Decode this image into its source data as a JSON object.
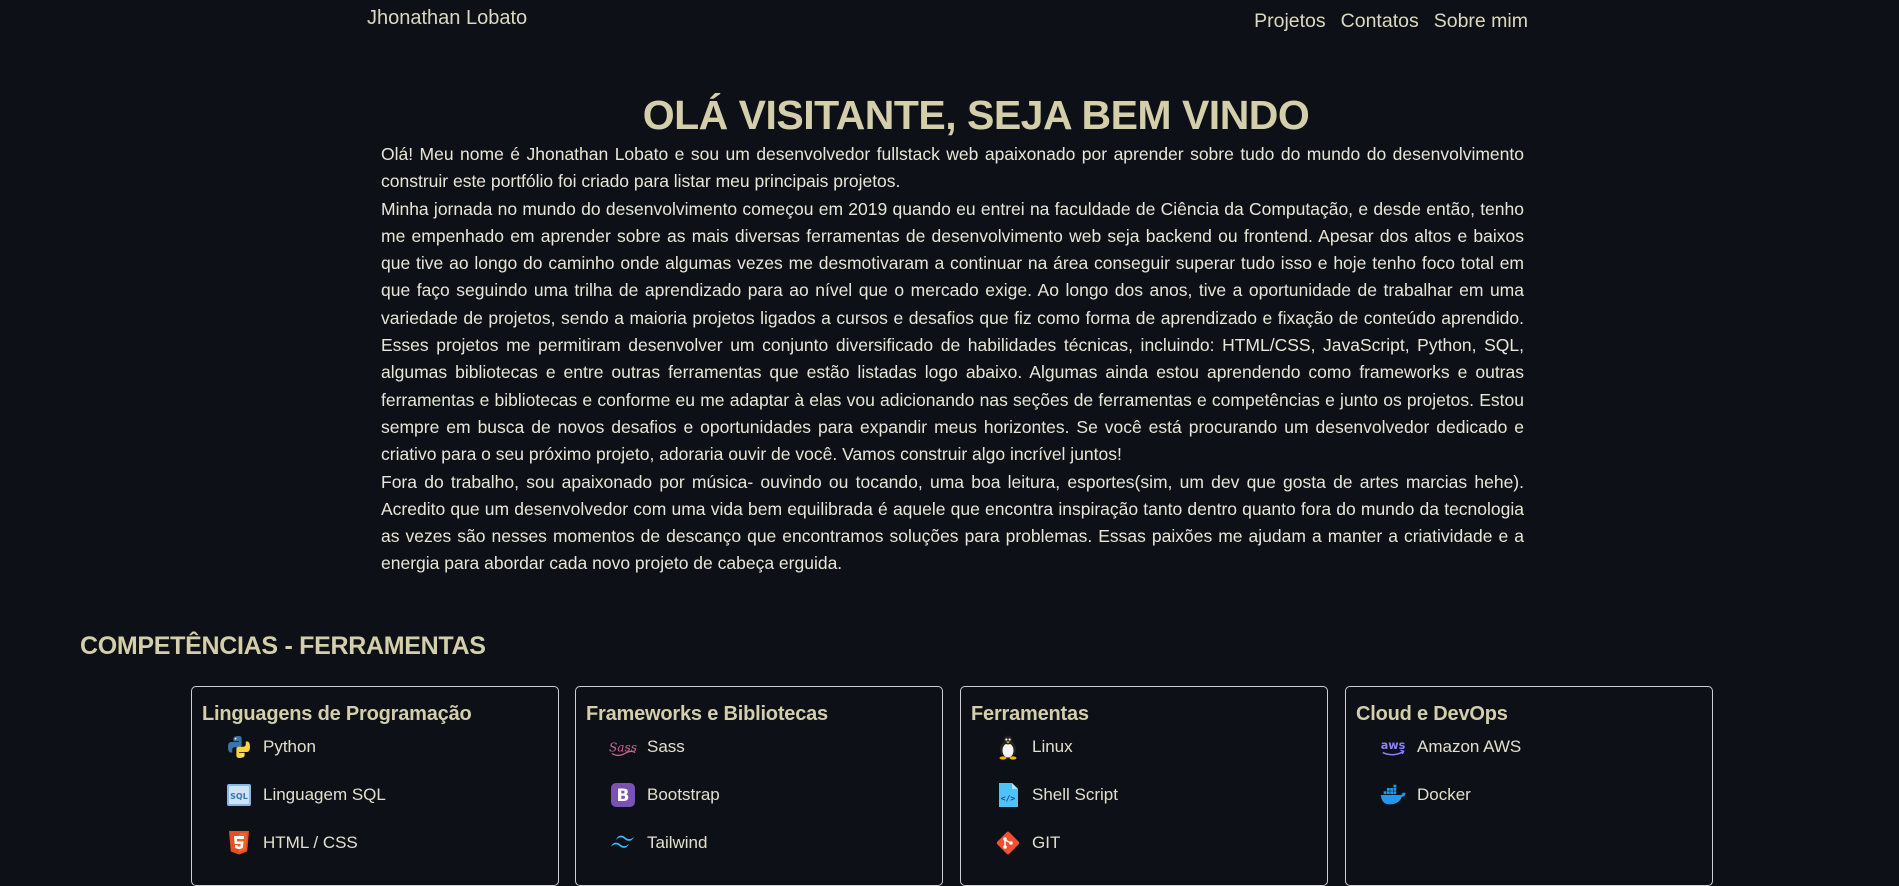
{
  "header": {
    "brand": "Jhonathan Lobato",
    "nav": [
      "Projetos",
      "Contatos",
      "Sobre mim"
    ]
  },
  "hero": {
    "title": "OLÁ VISITANTE, SEJA BEM VINDO",
    "paragraphs": [
      "Olá! Meu nome é Jhonathan Lobato e sou um desenvolvedor fullstack web apaixonado por aprender sobre tudo do mundo do desenvolvimento construir este portfólio foi criado para listar meu principais projetos.",
      "Minha jornada no mundo do desenvolvimento começou em 2019 quando eu entrei na faculdade de Ciência da Computação, e desde então, tenho me empenhado em aprender sobre as mais diversas ferramentas de desenvolvimento web seja backend ou frontend. Apesar dos altos e baixos que tive ao longo do caminho onde algumas vezes me desmotivaram a continuar na área conseguir superar tudo isso e hoje tenho foco total em que faço seguindo uma trilha de aprendizado para ao nível que o mercado exige. Ao longo dos anos, tive a oportunidade de trabalhar em uma variedade de projetos, sendo a maioria projetos ligados a cursos e desafios que fiz como forma de aprendizado e fixação de conteúdo aprendido. Esses projetos me permitiram desenvolver um conjunto diversificado de habilidades técnicas, incluindo: HTML/CSS, JavaScript, Python, SQL, algumas bibliotecas e entre outras ferramentas que estão listadas logo abaixo. Algumas ainda estou aprendendo como frameworks e outras ferramentas e bibliotecas e conforme eu me adaptar à elas vou adicionando nas seções de ferramentas e competências e junto os projetos. Estou sempre em busca de novos desafios e oportunidades para expandir meus horizontes. Se você está procurando um desenvolvedor dedicado e criativo para o seu próximo projeto, adoraria ouvir de você. Vamos construir algo incrível juntos!",
      "Fora do trabalho, sou apaixonado por música- ouvindo ou tocando, uma boa leitura, esportes(sim, um dev que gosta de artes marcias hehe). Acredito que um desenvolvedor com uma vida bem equilibrada é aquele que encontra inspiração tanto dentro quanto fora do mundo da tecnologia as vezes são nesses momentos de descanço que encontramos soluções para problemas. Essas paixões me ajudam a manter a criatividade e a energia para abordar cada novo projeto de cabeça erguida."
    ]
  },
  "skills": {
    "title": "COMPETÊNCIAS - FERRAMENTAS",
    "cards": [
      {
        "title": "Linguagens de Programação",
        "items": [
          {
            "label": "Python",
            "icon": "python-icon"
          },
          {
            "label": "Linguagem SQL",
            "icon": "sql-icon"
          },
          {
            "label": "HTML / CSS",
            "icon": "html5-icon"
          }
        ]
      },
      {
        "title": "Frameworks e Bibliotecas",
        "items": [
          {
            "label": "Sass",
            "icon": "sass-icon"
          },
          {
            "label": "Bootstrap",
            "icon": "bootstrap-icon"
          },
          {
            "label": "Tailwind",
            "icon": "tailwind-icon"
          }
        ]
      },
      {
        "title": "Ferramentas",
        "items": [
          {
            "label": "Linux",
            "icon": "linux-icon"
          },
          {
            "label": "Shell Script",
            "icon": "shell-script-icon"
          },
          {
            "label": "GIT",
            "icon": "git-icon"
          }
        ]
      },
      {
        "title": "Cloud e DevOps",
        "items": [
          {
            "label": "Amazon AWS",
            "icon": "aws-icon"
          },
          {
            "label": "Docker",
            "icon": "docker-icon"
          }
        ]
      }
    ]
  },
  "colors": {
    "background": "#0d1117",
    "heading": "#d4cfaa",
    "text": "#e9e6d6"
  }
}
